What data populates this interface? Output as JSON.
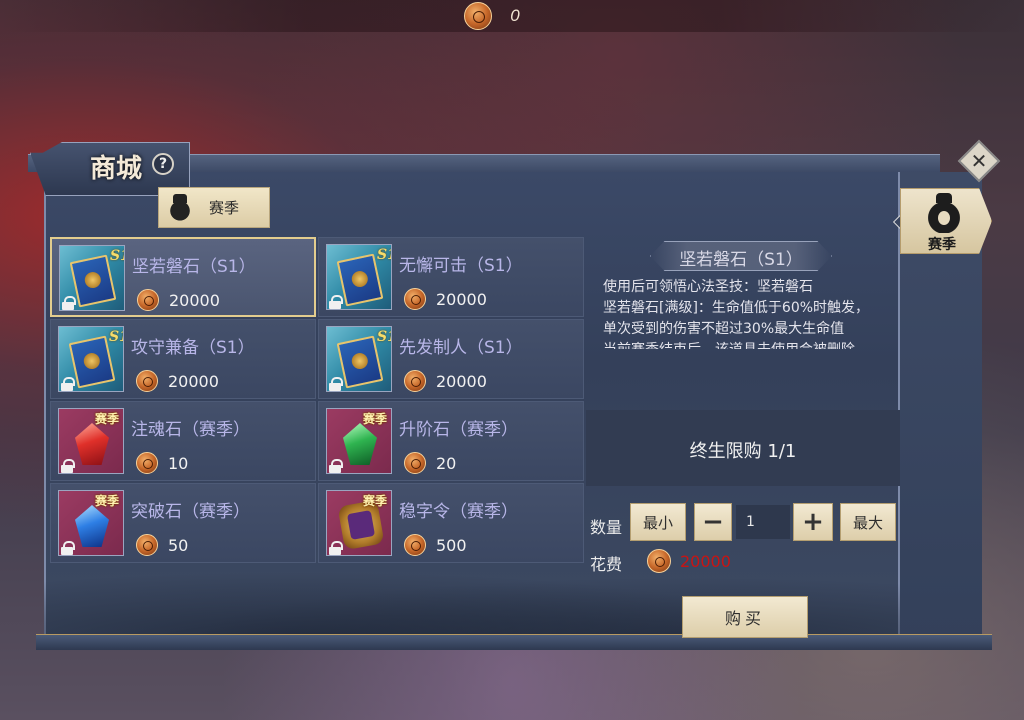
{
  "top_bar": {
    "currency_value": "0"
  },
  "header": {
    "title": "商城",
    "help_symbol": "?",
    "close_symbol": "✕"
  },
  "tabs": {
    "season_tab_label": "赛季",
    "side_tab_label": "赛季"
  },
  "items": [
    {
      "name": "坚若磐石（S1）",
      "price": "20000",
      "tag": "S1",
      "selected": true
    },
    {
      "name": "无懈可击（S1）",
      "price": "20000",
      "tag": "S1",
      "selected": false
    },
    {
      "name": "攻守兼备（S1）",
      "price": "20000",
      "tag": "S1",
      "selected": false
    },
    {
      "name": "先发制人（S1）",
      "price": "20000",
      "tag": "S1",
      "selected": false
    },
    {
      "name": "注魂石（赛季）",
      "price": "10",
      "tag": "赛季",
      "selected": false
    },
    {
      "name": "升阶石（赛季）",
      "price": "20",
      "tag": "赛季",
      "selected": false
    },
    {
      "name": "突破石（赛季）",
      "price": "50",
      "tag": "赛季",
      "selected": false
    },
    {
      "name": "稳字令（赛季）",
      "price": "500",
      "tag": "赛季",
      "selected": false
    }
  ],
  "detail": {
    "title": "坚若磐石（S1）",
    "description": [
      "使用后可领悟心法圣技：坚若磐石",
      "坚若磐石[满级]：生命值低于60%时触发，",
      "单次受到的伤害不超过30%最大生命值",
      "当前赛季结束后，该道具未使用会被删除"
    ],
    "limit_text": "终生限购 1/1"
  },
  "purchase": {
    "quantity_label": "数量",
    "min_label": "最小",
    "minus_label": "−",
    "quantity_value": "1",
    "plus_label": "+",
    "max_label": "最大",
    "cost_label": "花费",
    "cost_value": "20000",
    "buy_label": "购买"
  },
  "colors": {
    "item_name": "#b8b6e8",
    "cost_value": "#c81414",
    "selected_border": "#e3cd8e"
  }
}
